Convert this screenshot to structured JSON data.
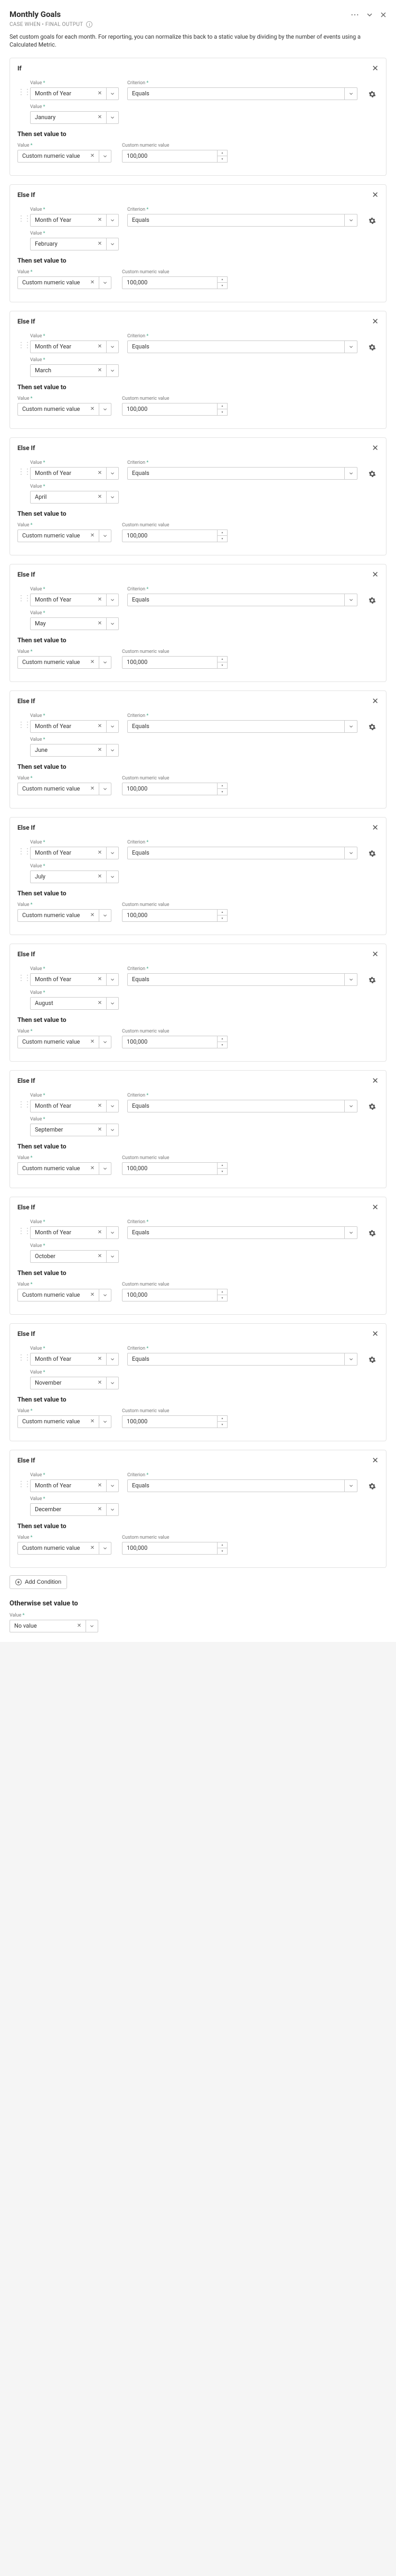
{
  "header": {
    "title": "Monthly Goals",
    "subtitle": "CASE WHEN • FINAL OUTPUT",
    "description": "Set custom goals for each month. For reporting, you can normalize this back to a static value by dividing by the number of events using a Calculated Metric."
  },
  "labels": {
    "if": "If",
    "else_if": "Else If",
    "value": "Value",
    "criterion": "Criterion",
    "custom_numeric_value": "Custom numeric value",
    "then_set_value_to": "Then set value to",
    "otherwise": "Otherwise set value to",
    "add_condition": "Add Condition",
    "required": "*"
  },
  "field_values": {
    "month_of_year": "Month of Year",
    "equals": "Equals",
    "custom_numeric_value": "Custom numeric value",
    "default_num": "100,000",
    "no_value": "No value"
  },
  "conditions": [
    {
      "header": "If",
      "month": "January",
      "result": "100,000"
    },
    {
      "header": "Else If",
      "month": "February",
      "result": "100,000"
    },
    {
      "header": "Else If",
      "month": "March",
      "result": "100,000"
    },
    {
      "header": "Else If",
      "month": "April",
      "result": "100,000"
    },
    {
      "header": "Else If",
      "month": "May",
      "result": "100,000"
    },
    {
      "header": "Else If",
      "month": "June",
      "result": "100,000"
    },
    {
      "header": "Else If",
      "month": "July",
      "result": "100,000"
    },
    {
      "header": "Else If",
      "month": "August",
      "result": "100,000"
    },
    {
      "header": "Else If",
      "month": "September",
      "result": "100,000"
    },
    {
      "header": "Else If",
      "month": "October",
      "result": "100,000"
    },
    {
      "header": "Else If",
      "month": "November",
      "result": "100,000"
    },
    {
      "header": "Else If",
      "month": "December",
      "result": "100,000"
    }
  ]
}
